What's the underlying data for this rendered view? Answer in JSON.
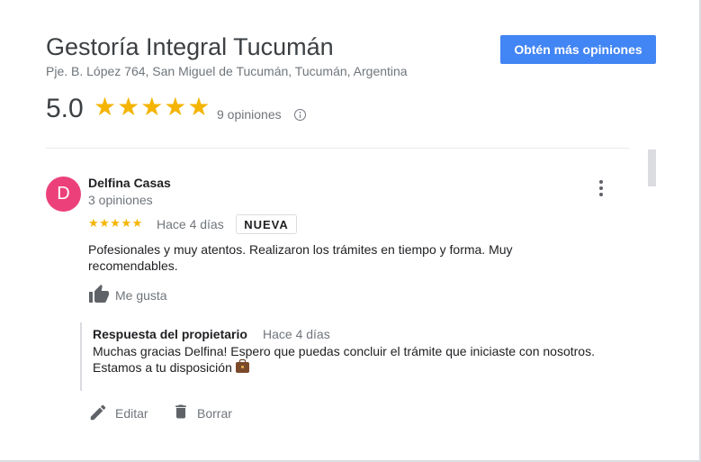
{
  "business": {
    "name": "Gestoría Integral Tucumán",
    "address": "Pje. B. López 764, San Miguel de Tucumán, Tucumán, Argentina",
    "get_reviews_label": "Obtén más opiniones",
    "rating_value": "5.0",
    "rating_stars": "★★★★★",
    "review_count": "9 opiniones"
  },
  "review": {
    "avatar_letter": "D",
    "avatar_color": "#ec407a",
    "reviewer_name": "Delfina Casas",
    "reviewer_reviews": "3 opiniones",
    "stars": "★★★★★",
    "rating": 5,
    "date": "Hace 4 días",
    "badge": "NUEVA",
    "text": "Pofesionales y muy atentos. Realizaron los trámites en tiempo y forma. Muy recomendables.",
    "like_label": "Me gusta"
  },
  "owner_reply": {
    "title": "Respuesta del propietario",
    "date": "Hace 4 días",
    "text": "Muchas gracias Delfina! Espero que puedas concluir el trámite que iniciaste con nosotros.\nEstamos a tu disposición",
    "emoji": "briefcase",
    "edit_label": "Editar",
    "delete_label": "Borrar"
  },
  "colors": {
    "accent": "#4285f4",
    "star": "#f4b400",
    "muted_text": "#70757a"
  }
}
